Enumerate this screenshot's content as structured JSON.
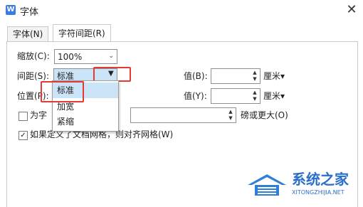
{
  "window": {
    "title": "字体",
    "app_icon": "W",
    "close_glyph": "✕"
  },
  "tabs": [
    {
      "label": "字体(N)",
      "active": false
    },
    {
      "label": "字符间距(R)",
      "active": true
    }
  ],
  "scale": {
    "label": "缩放(C):",
    "value": "100%"
  },
  "spacing": {
    "label": "间距(S):",
    "value": "标准",
    "value_label": "值(B):",
    "unit": "厘米▾"
  },
  "position": {
    "label": "位置(P):",
    "value_label": "值(Y):",
    "unit": "厘米▾"
  },
  "dropdown": {
    "options": [
      "标准",
      "加宽",
      "紧缩"
    ],
    "highlighted": "标准"
  },
  "kerning": {
    "label_prefix": "为字",
    "suffix": "磅或更大(O)",
    "checked": false
  },
  "grid_align": {
    "label": "如果定义了文档网格，则对齐网格(W)",
    "checked": true
  },
  "watermark": {
    "name": "系统之家",
    "domain": "XITONGZHIJIA.NET"
  },
  "colors": {
    "highlight": "#e53935",
    "selected": "#cce4f7",
    "accent": "#3b7be5"
  }
}
